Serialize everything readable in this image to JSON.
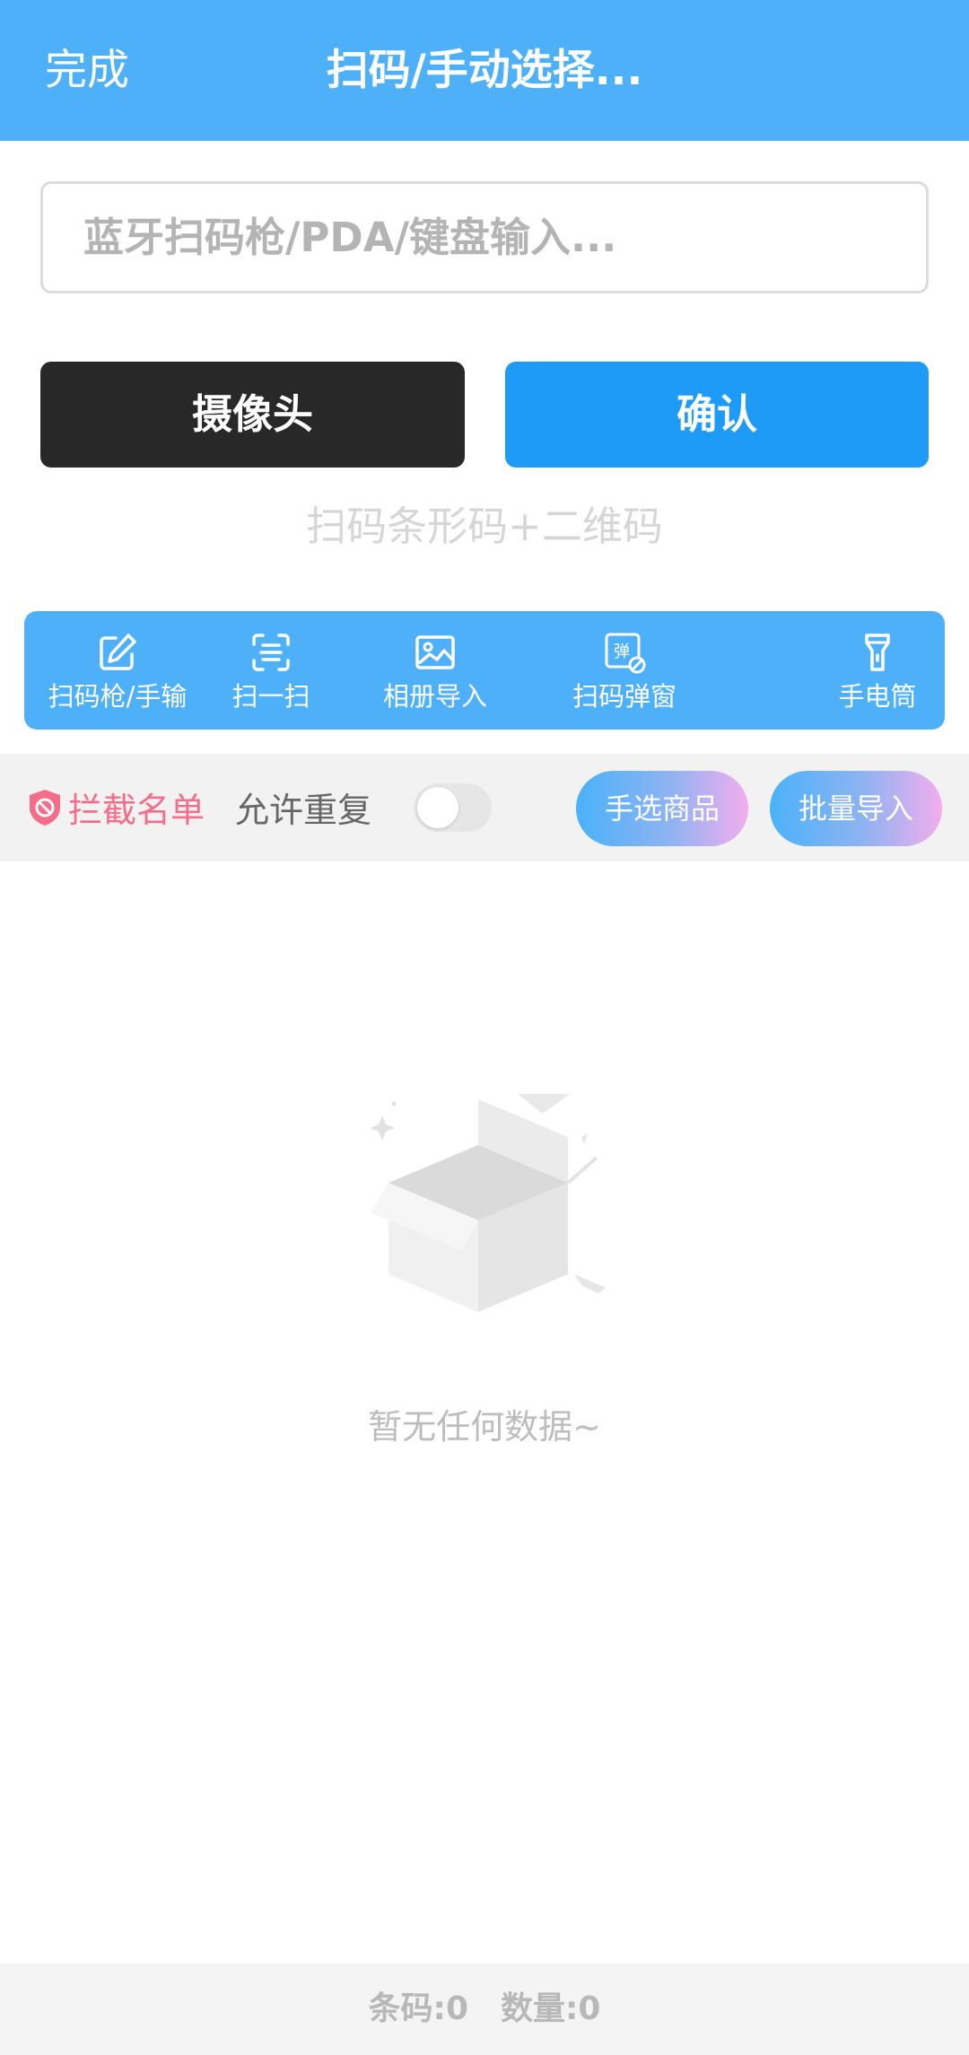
{
  "header": {
    "done_label": "完成",
    "title": "扫码/手动选择..."
  },
  "search": {
    "placeholder": "蓝牙扫码枪/PDA/键盘输入..."
  },
  "buttons": {
    "camera_label": "摄像头",
    "confirm_label": "确认"
  },
  "hint": "扫码条形码+二维码",
  "toolbar": {
    "items": [
      {
        "label": "扫码枪/手输",
        "icon": "edit-icon"
      },
      {
        "label": "扫一扫",
        "icon": "scan-icon"
      },
      {
        "label": "相册导入",
        "icon": "image-icon"
      },
      {
        "label": "扫码弹窗",
        "icon": "popup-icon",
        "icon_text": "弹"
      },
      {
        "label": "手电筒",
        "icon": "flashlight-icon"
      }
    ]
  },
  "filter": {
    "intercept_label": "拦截名单",
    "allow_duplicate_label": "允许重复",
    "allow_duplicate_on": false,
    "select_goods_label": "手选商品",
    "batch_import_label": "批量导入"
  },
  "empty": {
    "message": "暂无任何数据~"
  },
  "footer": {
    "barcode_label": "条码:0",
    "quantity_label": "数量:0"
  },
  "colors": {
    "primary": "#4eb0f9",
    "confirm": "#1d9bf7",
    "camera": "#282828",
    "intercept": "#f46e8c"
  }
}
